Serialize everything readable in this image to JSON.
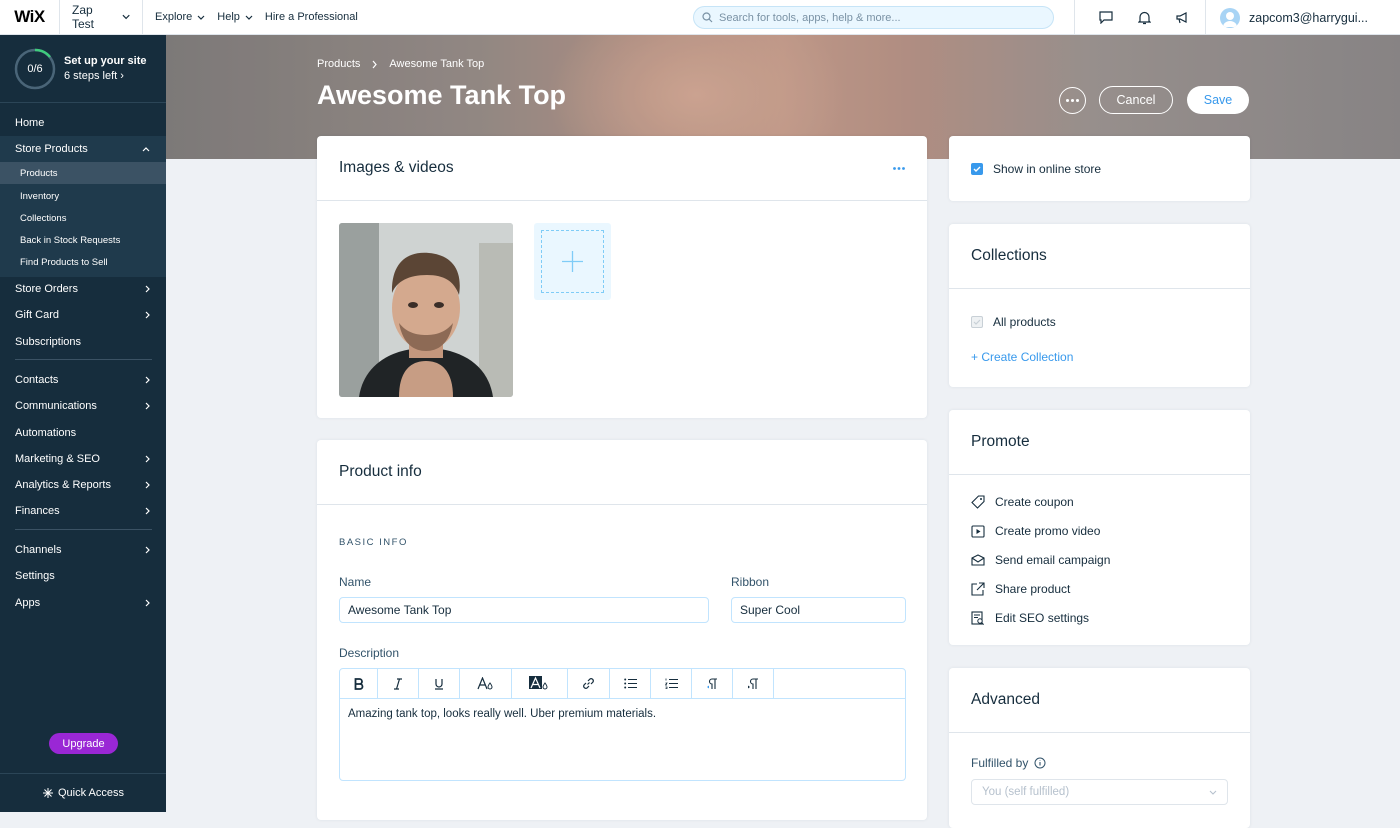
{
  "topbar": {
    "logo": "WiX",
    "site_name": "Zap Test",
    "nav": [
      "Explore",
      "Help",
      "Hire a Professional"
    ],
    "search_placeholder": "Search for tools, apps, help & more...",
    "account": "zapcom3@harrygui..."
  },
  "sidebar": {
    "setup_progress": "0/6",
    "setup_title": "Set up your site",
    "setup_steps": "6 steps left",
    "items": {
      "home": "Home",
      "store_products": "Store Products",
      "products": "Products",
      "inventory": "Inventory",
      "collections": "Collections",
      "back_in_stock": "Back in Stock Requests",
      "find_products": "Find Products to Sell",
      "store_orders": "Store Orders",
      "gift_card": "Gift Card",
      "subscriptions": "Subscriptions",
      "contacts": "Contacts",
      "communications": "Communications",
      "automations": "Automations",
      "marketing_seo": "Marketing & SEO",
      "analytics": "Analytics & Reports",
      "finances": "Finances",
      "channels": "Channels",
      "settings": "Settings",
      "apps": "Apps"
    },
    "upgrade": "Upgrade",
    "quick_access": "Quick Access"
  },
  "header": {
    "breadcrumb_root": "Products",
    "breadcrumb_current": "Awesome Tank Top",
    "title": "Awesome Tank Top",
    "cancel": "Cancel",
    "save": "Save"
  },
  "images_card": {
    "title": "Images & videos"
  },
  "product_info": {
    "title": "Product info",
    "section": "BASIC INFO",
    "name_label": "Name",
    "name_value": "Awesome Tank Top",
    "ribbon_label": "Ribbon",
    "ribbon_value": "Super Cool",
    "description_label": "Description",
    "description_value": "Amazing tank top, looks really well. Uber premium materials."
  },
  "visibility": {
    "show_online": "Show in online store"
  },
  "collections": {
    "title": "Collections",
    "all_products": "All products",
    "create": "+ Create Collection"
  },
  "promote": {
    "title": "Promote",
    "actions": [
      "Create coupon",
      "Create promo video",
      "Send email campaign",
      "Share product",
      "Edit SEO settings"
    ]
  },
  "advanced": {
    "title": "Advanced",
    "fulfilled_label": "Fulfilled by",
    "fulfilled_value": "You (self fulfilled)"
  },
  "colors": {
    "sidebar": "#162d3d",
    "accent": "#3899ec",
    "upgrade": "#9a27d5"
  }
}
